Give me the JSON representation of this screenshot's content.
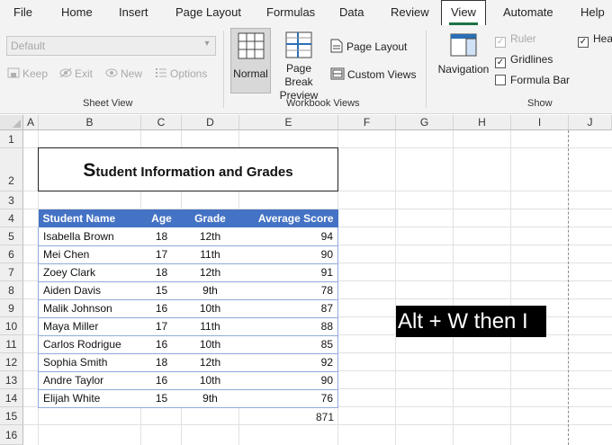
{
  "menu": {
    "items": [
      "File",
      "Home",
      "Insert",
      "Page Layout",
      "Formulas",
      "Data",
      "Review",
      "View",
      "Automate",
      "Help"
    ],
    "active": "View"
  },
  "ribbon": {
    "sheet_view": {
      "dropdown_value": "Default",
      "keep": "Keep",
      "exit": "Exit",
      "new": "New",
      "options": "Options",
      "label": "Sheet View"
    },
    "workbook_views": {
      "normal": "Normal",
      "page_break_line1": "Page Break",
      "page_break_line2": "Preview",
      "page_layout": "Page Layout",
      "custom_views": "Custom Views",
      "label": "Workbook Views"
    },
    "show": {
      "navigation": "Navigation",
      "ruler": "Ruler",
      "gridlines": "Gridlines",
      "formula_bar": "Formula Bar",
      "headings": "Hea",
      "label": "Show"
    }
  },
  "grid": {
    "columns": [
      "A",
      "B",
      "C",
      "D",
      "E",
      "F",
      "G",
      "H",
      "I",
      "J"
    ],
    "rows": [
      "1",
      "2",
      "3",
      "4",
      "5",
      "6",
      "7",
      "8",
      "9",
      "10",
      "11",
      "12",
      "13",
      "14",
      "15",
      "16"
    ]
  },
  "sheet": {
    "title": "Student Information and Grades",
    "headers": [
      "Student Name",
      "Age",
      "Grade",
      "Average Score"
    ],
    "rows": [
      [
        "Isabella Brown",
        "18",
        "12th",
        "94"
      ],
      [
        "Mei Chen",
        "17",
        "11th",
        "90"
      ],
      [
        "Zoey Clark",
        "18",
        "12th",
        "91"
      ],
      [
        "Aiden Davis",
        "15",
        "9th",
        "78"
      ],
      [
        "Malik Johnson",
        "16",
        "10th",
        "87"
      ],
      [
        "Maya Miller",
        "17",
        "11th",
        "88"
      ],
      [
        "Carlos Rodrigue",
        "16",
        "10th",
        "85"
      ],
      [
        "Sophia Smith",
        "18",
        "12th",
        "92"
      ],
      [
        "Andre Taylor",
        "16",
        "10th",
        "90"
      ],
      [
        "Elijah White",
        "15",
        "9th",
        "76"
      ]
    ],
    "total": "871"
  },
  "overlay": {
    "shortcut": "Alt + W then I"
  },
  "colors": {
    "table_header": "#4472c4",
    "table_border": "#8eaadb",
    "accent": "#1e7145"
  }
}
